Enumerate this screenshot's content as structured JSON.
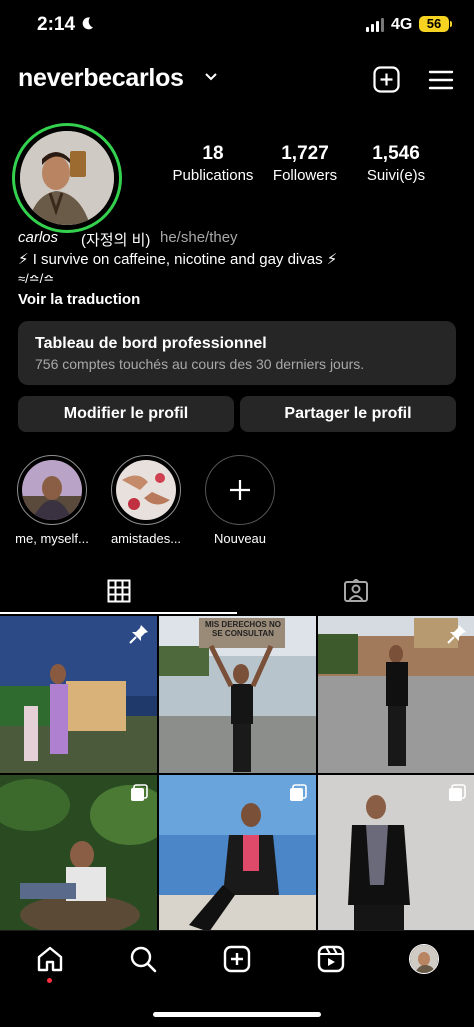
{
  "status_bar": {
    "time": "2:14",
    "network": "4G",
    "battery": "56",
    "moon_icon": "moon-icon",
    "signal_icon": "signal-icon"
  },
  "header": {
    "username": "neverbecarlos",
    "create_icon": "plus-square-icon",
    "menu_icon": "hamburger-menu-icon"
  },
  "stats": [
    {
      "value": "18",
      "label": "Publications"
    },
    {
      "value": "1,727",
      "label": "Followers"
    },
    {
      "value": "1,546",
      "label": "Suivi(e)s"
    }
  ],
  "bio": {
    "name": "carlos",
    "korean": "(자정의 비)",
    "pronouns": "he/she/they",
    "line1": "⚡ I survive on caffeine, nicotine and gay divas ⚡",
    "line2": "≈/≏/≏",
    "translate": "Voir la traduction"
  },
  "dashboard": {
    "title": "Tableau de bord professionnel",
    "subtitle": "756 comptes touchés au cours des 30 derniers jours."
  },
  "buttons": {
    "edit": "Modifier le profil",
    "share": "Partager le profil"
  },
  "highlights": [
    {
      "label": "me, myself..."
    },
    {
      "label": "amistades..."
    },
    {
      "label": "Nouveau"
    }
  ],
  "tiles": [
    {
      "sign": ""
    },
    {
      "sign": "MIS DERECHOS NO SE CONSULTAN"
    },
    {
      "sign": ""
    },
    {
      "sign": ""
    },
    {
      "sign": ""
    },
    {
      "sign": ""
    }
  ],
  "colors": {
    "story_ring": "#33d14e",
    "battery": "#f5d320",
    "panel": "#262626",
    "notif_dot": "#ff3040"
  }
}
